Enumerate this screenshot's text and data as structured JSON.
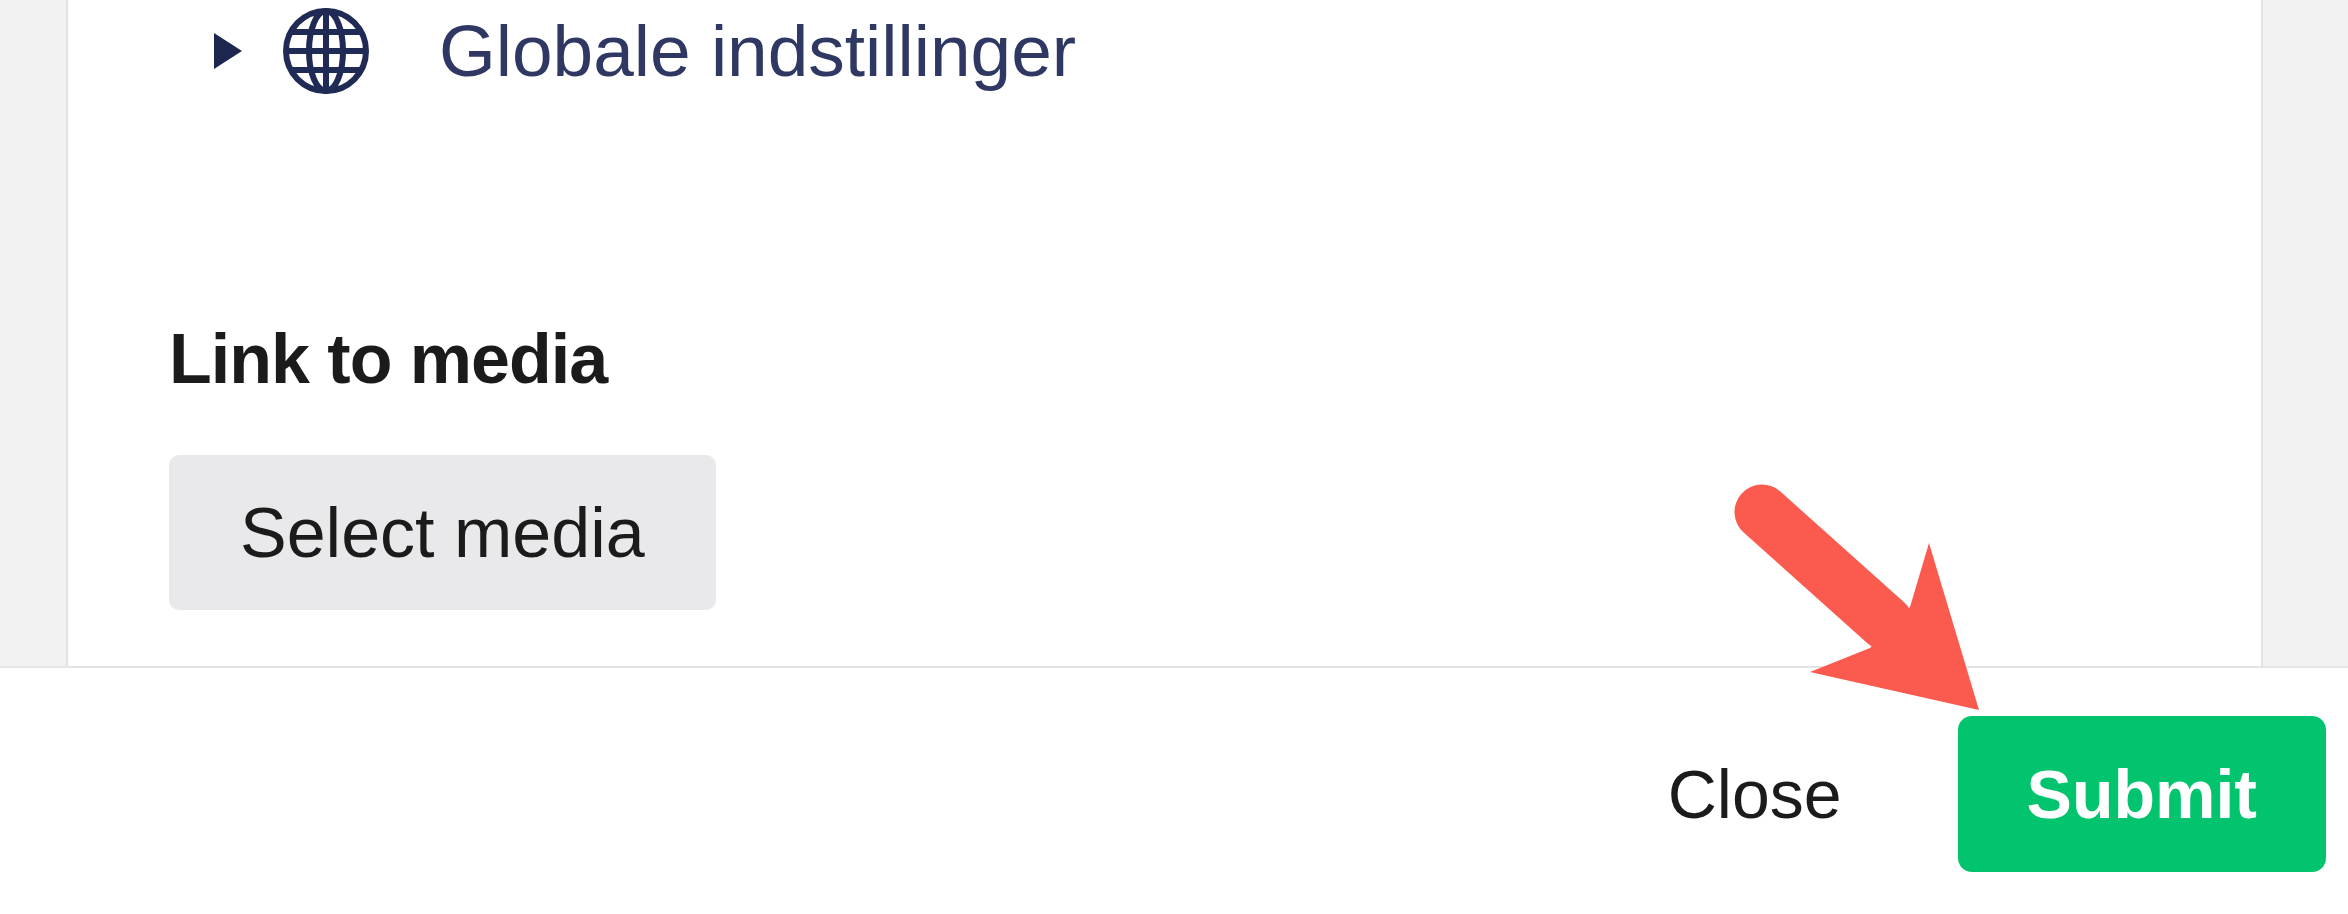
{
  "tree": {
    "items": [
      {
        "label": "Globale indstillinger",
        "expanded": false
      }
    ]
  },
  "media_field": {
    "label": "Link to media",
    "button": "Select media"
  },
  "footer": {
    "buttons": [
      {
        "label": "Close",
        "kind": "link"
      },
      {
        "label": "Submit",
        "kind": "primary"
      }
    ]
  }
}
